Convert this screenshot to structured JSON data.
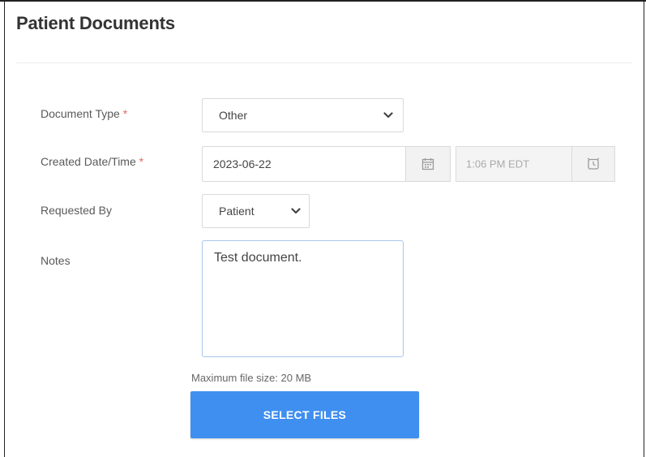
{
  "page": {
    "title": "Patient Documents"
  },
  "form": {
    "document_type": {
      "label": "Document Type",
      "required_marker": "*",
      "value": "Other"
    },
    "created_datetime": {
      "label": "Created Date/Time",
      "required_marker": "*",
      "date_value": "2023-06-22",
      "time_value": "1:06 PM EDT"
    },
    "requested_by": {
      "label": "Requested By",
      "value": "Patient"
    },
    "notes": {
      "label": "Notes",
      "value": "Test document."
    },
    "upload": {
      "max_size_text": "Maximum file size: 20 MB",
      "button_label": "SELECT FILES"
    }
  },
  "colors": {
    "primary_button": "#3f8ff0",
    "required_marker": "#e06a6a",
    "notes_focus_border": "#a9c6ea"
  },
  "icons": {
    "dropdown": "chevron-down-icon",
    "date_picker": "calendar-icon",
    "time_picker": "clock-icon"
  }
}
